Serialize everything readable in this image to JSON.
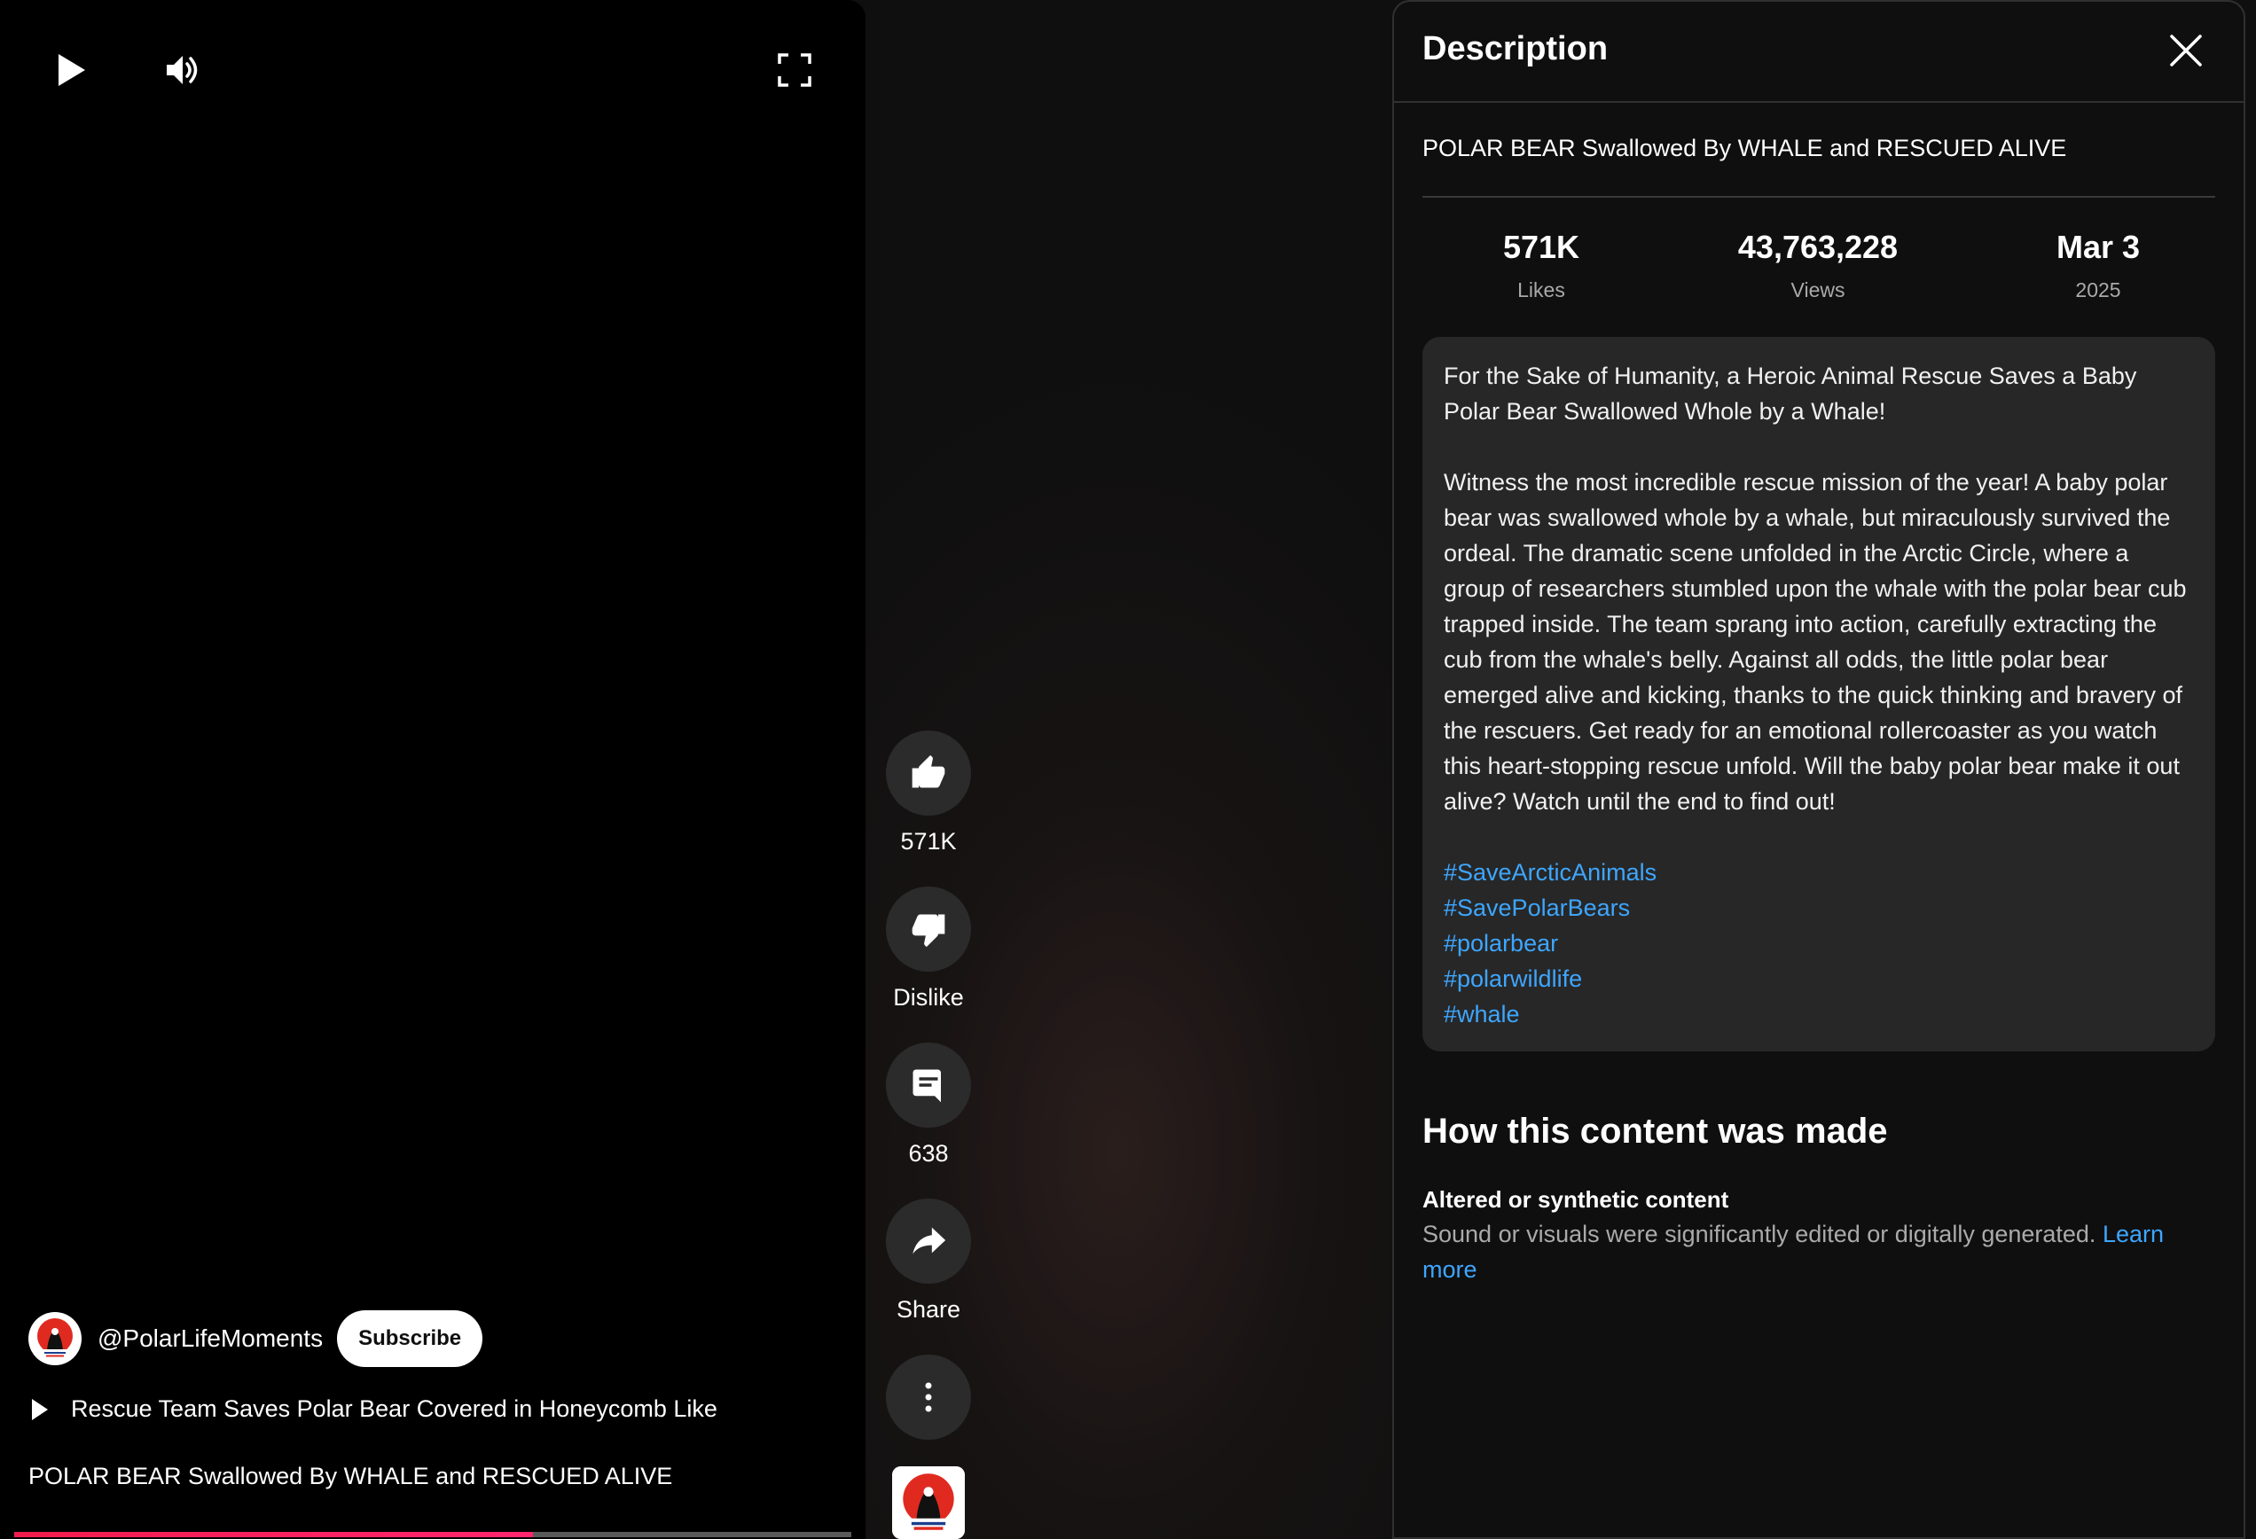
{
  "player": {
    "icons": [
      "play-icon",
      "volume-icon",
      "fullscreen-icon"
    ],
    "channel_handle": "@PolarLifeMoments",
    "subscribe_label": "Subscribe",
    "playlist_title": "Rescue Team Saves Polar Bear Covered in Honeycomb Like",
    "video_title": "POLAR BEAR Swallowed By WHALE and RESCUED ALIVE",
    "progress_fraction": 0.62,
    "progress_color": "#f21c4d"
  },
  "actions": {
    "like_label": "571K",
    "dislike_label": "Dislike",
    "comments_label": "638",
    "share_label": "Share"
  },
  "description_panel": {
    "title": "Description",
    "video_title": "POLAR BEAR Swallowed By WHALE and RESCUED ALIVE",
    "stats": {
      "likes_value": "571K",
      "likes_label": "Likes",
      "views_value": "43,763,228",
      "views_label": "Views",
      "date_value": "Mar 3",
      "date_label": "2025"
    },
    "paragraph1": "For the Sake of Humanity, a Heroic Animal Rescue Saves a Baby Polar Bear Swallowed Whole by a Whale!",
    "paragraph2": "Witness the most incredible rescue mission of the year! A baby polar bear was swallowed whole by a whale, but miraculously survived the ordeal. The dramatic scene unfolded in the Arctic Circle, where a group of researchers stumbled upon the whale with the polar bear cub trapped inside. The team sprang into action, carefully extracting the cub from the whale's belly. Against all odds, the little polar bear emerged alive and kicking, thanks to the quick thinking and bravery of the rescuers. Get ready for an emotional rollercoaster as you watch this heart-stopping rescue unfold. Will the baby polar bear make it out alive? Watch until the end to find out!",
    "hashtags": [
      "#SaveArcticAnimals",
      "#SavePolarBears",
      "#polarbear",
      "#polarwildlife",
      "#whale"
    ],
    "made_title": "How this content was made",
    "made_subtitle": "Altered or synthetic content",
    "made_text": "Sound or visuals were significantly edited or digitally generated.",
    "learn_more_label": "Learn more",
    "link_color": "#3ea6ff"
  }
}
